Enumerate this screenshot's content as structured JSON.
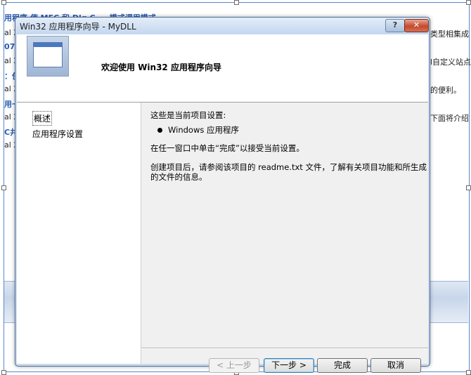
{
  "background_doc": {
    "left_fragments": [
      {
        "text": "用程序  使 MFC  和 Dlg  C  ... 模式调用模式",
        "blue": true
      },
      {
        "text": "al 2",
        "blue": false
      },
      {
        "text": "07:",
        "blue": true
      },
      {
        "text": "al 2",
        "blue": false
      },
      {
        "text": "：使",
        "blue": true
      },
      {
        "text": "al 2",
        "blue": false
      },
      {
        "text": "用一",
        "blue": true
      },
      {
        "text": "al 2",
        "blue": false
      },
      {
        "text": "C井",
        "blue": true
      },
      {
        "text": "al 2",
        "blue": false
      }
    ],
    "right_fragments": [
      "类型相集成",
      "l自定义站点",
      "的便利。",
      "下面将介绍"
    ]
  },
  "dialog": {
    "title": "Win32 应用程序向导 - MyDLL",
    "help_label": "?",
    "close_label": "✕",
    "header_title": "欢迎使用 Win32 应用程序向导",
    "nav_items": [
      "概述",
      "应用程序设置"
    ],
    "content": {
      "line1": "这些是当前项目设置:",
      "bullet": "Windows 应用程序",
      "line2": "在任一窗口中单击“完成”以接受当前设置。",
      "line3": "创建项目后，请参阅该项目的 readme.txt 文件，了解有关项目功能和所生成的文件的信息。"
    },
    "buttons": {
      "prev": "< 上一步",
      "next": "下一步 >",
      "finish": "完成",
      "cancel": "取消"
    }
  }
}
